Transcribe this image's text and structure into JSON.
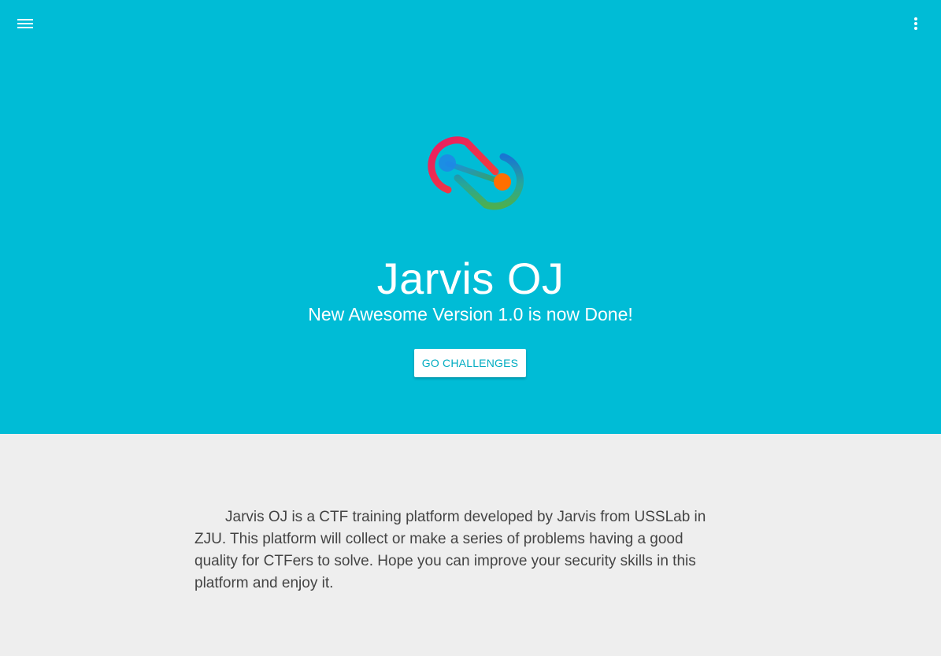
{
  "header": {
    "menu_icon": "hamburger-menu-icon",
    "more_icon": "more-vertical-icon"
  },
  "hero": {
    "logo_icon": "infinity-link-logo",
    "title": "Jarvis OJ",
    "subtitle": "New Awesome Version 1.0 is now Done!",
    "cta_label": "GO CHALLENGES",
    "background_color": "#00bcd6",
    "accent_color": "#00acc1"
  },
  "main": {
    "description": "Jarvis OJ is a CTF training platform developed by Jarvis from USSLab in ZJU. This platform will collect or make a series of problems having a good quality for CTFers to solve. Hope you can improve your security skills in this platform and enjoy it.",
    "background_color": "#eeeeee"
  }
}
